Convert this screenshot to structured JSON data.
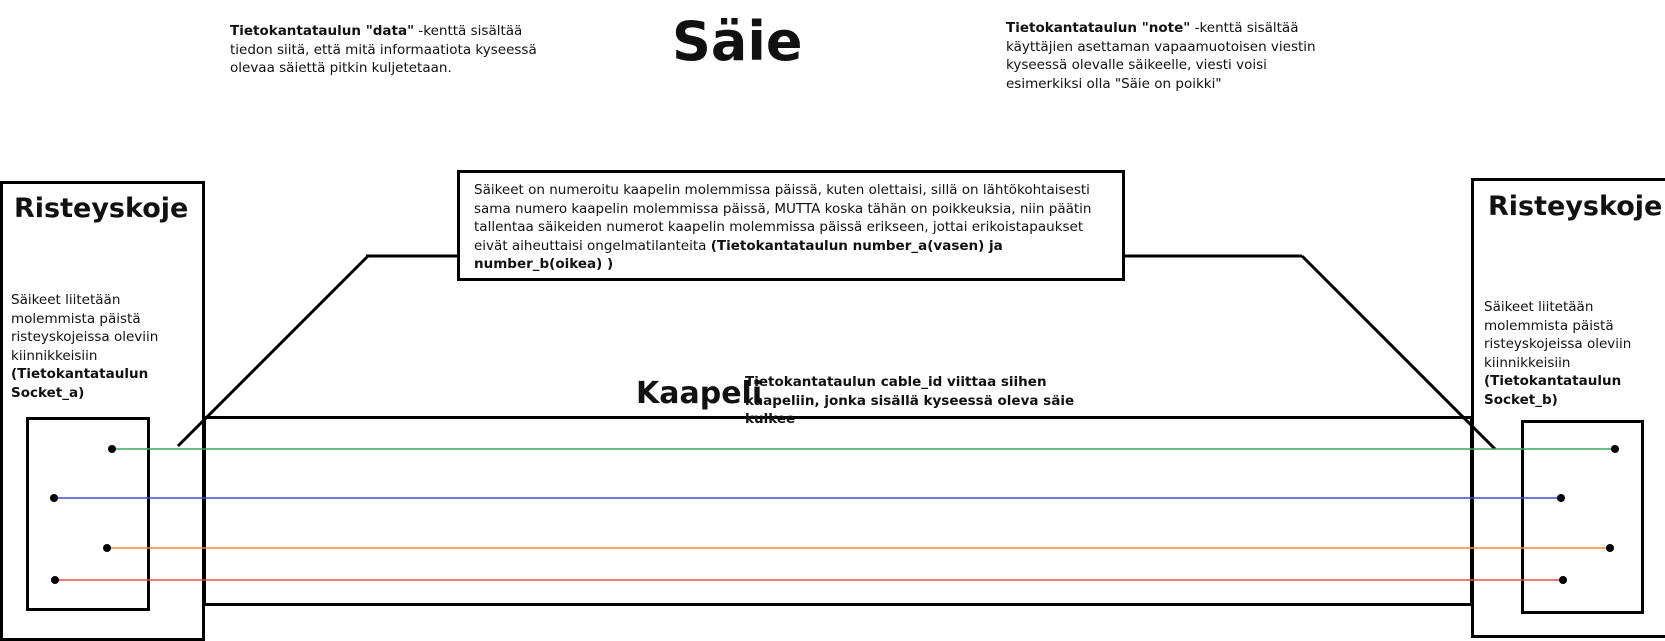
{
  "title": "Säie",
  "data_note": {
    "bold": "Tietokantataulun \"data\"",
    "text": " -kenttä sisältää tiedon siitä, että mitä informaatiota kyseessä olevaa säiettä pitkin kuljetetaan."
  },
  "note_note": {
    "bold": "Tietokantataulun \"note\"",
    "text": " -kenttä sisältää käyttäjien asettaman vapaamuotoisen viestin kyseessä olevalle säikeelle, viesti voisi esimerkiksi olla \"Säie on poikki\""
  },
  "numbering_note": {
    "text": "Säikeet on numeroitu kaapelin molemmissa päissä, kuten olettaisi, sillä on lähtökohtaisesti sama numero kaapelin molemmissa päissä, MUTTA koska tähän on poikkeuksia, niin päätin tallentaa säikeiden numerot kaapelin molemmissa päissä erikseen, jottai erikoistapaukset eivät aiheuttaisi ongelmatilanteita ",
    "bold": "(Tietokantataulun number_a(vasen) ja number_b(oikea) )"
  },
  "left_device": {
    "title": "Risteyskoje",
    "text": "Säikeet liitetään molemmista päistä risteyskojeissa oleviin kiinnikkeisiin",
    "bold": "(Tietokantataulun Socket_a)"
  },
  "right_device": {
    "title": "Risteyskoje",
    "text": "Säikeet liitetään molemmista päistä risteyskojeissa oleviin kiinnikkeisiin",
    "bold": "(Tietokantataulun Socket_b)"
  },
  "cable": {
    "label": "Kaapeli",
    "note": "Tietokantataulun cable_id viittaa siihen kaapeliin, jonka sisällä kyseessä oleva säie kulkee"
  },
  "colors": {
    "strand_green": "#3aa55a",
    "strand_blue": "#3a4fd0",
    "strand_orange": "#f08a3c",
    "strand_red": "#e05050",
    "outline": "#000000"
  }
}
